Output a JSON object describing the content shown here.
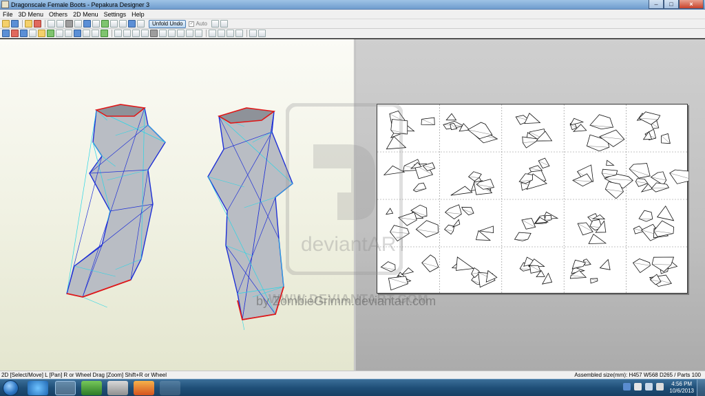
{
  "window": {
    "title": "Dragonscale Female Boots - Pepakura Designer 3"
  },
  "menu": [
    "File",
    "3D Menu",
    "Others",
    "2D Menu",
    "Settings",
    "Help"
  ],
  "toolbar": {
    "unfold_undo": "Unfold Undo",
    "auto_label": "Auto"
  },
  "status": {
    "left": "2D [Select/Move] L [Pan] R or Wheel Drag [Zoom] Shift+R or Wheel",
    "right": "Assembled size(mm): H457 W568 D265 / Parts 100"
  },
  "taskbar": {
    "time": "4:56 PM",
    "date": "10/6/2013"
  },
  "watermark": {
    "brand": "deviantART",
    "url": "WWW.DEVIANTART.COM",
    "credit": "by ZombieGrimm.deviantart.com"
  },
  "colors": {
    "mesh_blue": "#1e2fd6",
    "mesh_cyan": "#27d6e6",
    "cut_red": "#e01818",
    "face_gray": "#b9bdc4"
  },
  "icons": [
    "app-icon",
    "start-orb",
    "ie-icon",
    "explorer-icon",
    "pepakura-icon",
    "folder-icon",
    "media-icon",
    "network-icon",
    "volume-icon"
  ]
}
